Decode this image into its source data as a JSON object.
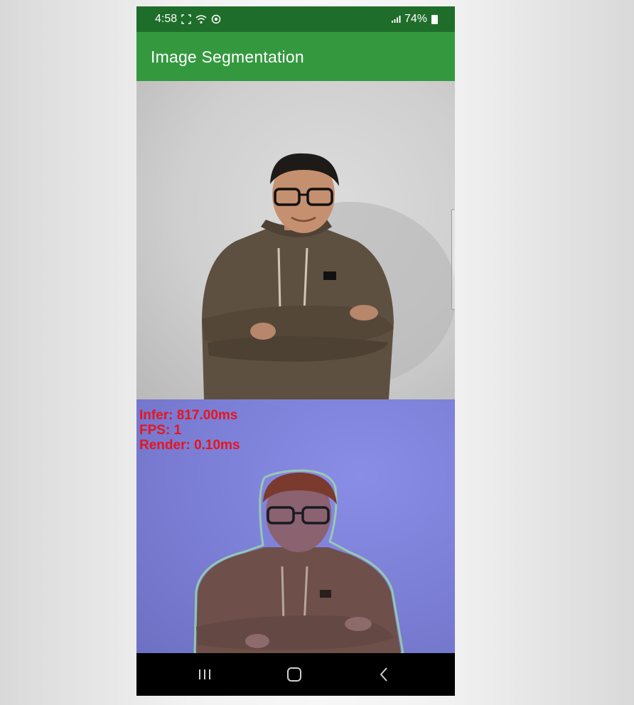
{
  "status_bar": {
    "time": "4:58",
    "battery": "74%",
    "icons": [
      "screenshot-frame-icon",
      "wifi-icon",
      "sync-icon",
      "signal-icon",
      "battery-icon"
    ]
  },
  "app_bar": {
    "title": "Image Segmentation",
    "color": "#34983f"
  },
  "output_view": {
    "stats": {
      "infer": "Infer: 817.00ms",
      "fps": "FPS: 1",
      "render": "Render: 0.10ms"
    },
    "stats_color": "#e8141e",
    "mask_color": "#7c7fd6"
  },
  "nav_bar": {
    "icons": [
      "recent-apps-icon",
      "home-icon",
      "back-icon"
    ]
  }
}
